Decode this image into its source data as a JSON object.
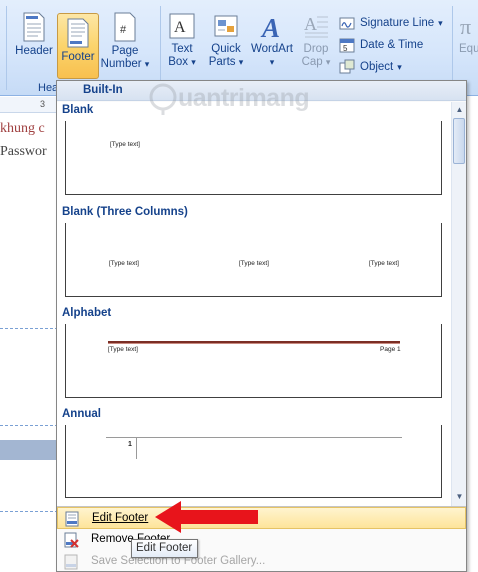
{
  "ribbon": {
    "header_label": "Header",
    "footer_label": "Footer",
    "page_label_1": "Page",
    "page_label_2": "Number",
    "page_arrow": "▾",
    "textbox_label_1": "Text",
    "textbox_label_2": "Box",
    "quickparts_label_1": "Quick",
    "quickparts_label_2": "Parts",
    "wordart_label": "WordArt",
    "dropcap_label_1": "Drop",
    "dropcap_label_2": "Cap",
    "signature_label": "Signature Line",
    "datetime_label": "Date & Time",
    "object_label": "Object",
    "dropdown_arrow": "▾",
    "group_label_partial": "Hea",
    "equation_partial": "Equ"
  },
  "document": {
    "ruler_mark": "3",
    "line1": "khung c",
    "line2": "Passwor"
  },
  "gallery": {
    "header": "Built-In",
    "sections": [
      {
        "title": "Blank",
        "placeholders": [
          "[Type text]"
        ]
      },
      {
        "title": "Blank (Three Columns)",
        "placeholders": [
          "[Type text]",
          "[Type text]",
          "[Type text]"
        ]
      },
      {
        "title": "Alphabet",
        "placeholders": [
          "[Type text]"
        ],
        "page_text": "Page 1"
      },
      {
        "title": "Annual",
        "page_num": "1"
      }
    ]
  },
  "scrollbar": {
    "up": "▲",
    "down": "▼"
  },
  "menu": {
    "edit_footer": "Edit Footer",
    "remove_footer": "Remove Footer",
    "save_selection": "Save Selection to Footer Gallery..."
  },
  "tooltip": {
    "text": "Edit Footer"
  },
  "watermark": {
    "text": "uantrimang"
  },
  "colors": {
    "ribbon_text": "#15428b",
    "active_button": "#fbd46c",
    "alphabet_rule": "#7b2e25",
    "red_arrow": "#e8141b"
  }
}
